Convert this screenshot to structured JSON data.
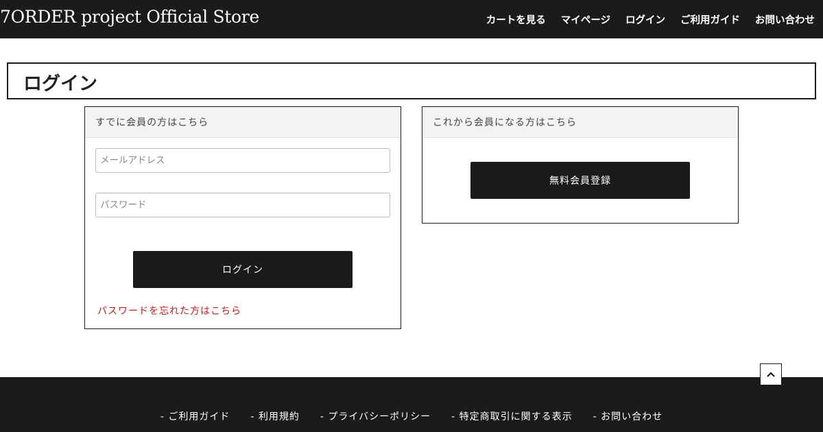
{
  "header": {
    "site_title": "7ORDER project Official Store",
    "nav": [
      {
        "label": "カートを見る"
      },
      {
        "label": "マイページ"
      },
      {
        "label": "ログイン"
      },
      {
        "label": "ご利用ガイド"
      },
      {
        "label": "お問い合わせ"
      }
    ]
  },
  "page": {
    "title": "ログイン"
  },
  "login_panel": {
    "heading": "すでに会員の方はこちら",
    "email_placeholder": "メールアドレス",
    "email_value": "",
    "password_placeholder": "パスワード",
    "password_value": "",
    "login_button": "ログイン",
    "forgot_link": "パスワードを忘れた方はこちら"
  },
  "register_panel": {
    "heading": "これから会員になる方はこちら",
    "register_button": "無料会員登録"
  },
  "back_to_top": {
    "icon": "chevron-up-icon"
  },
  "footer": {
    "links": [
      {
        "label": "- ご利用ガイド"
      },
      {
        "label": "- 利用規約"
      },
      {
        "label": "- プライバシーポリシー"
      },
      {
        "label": "- 特定商取引に関する表示"
      },
      {
        "label": "- お問い合わせ"
      }
    ]
  },
  "colors": {
    "header_bg": "#1b1b1b",
    "button_bg": "#1b1b1b",
    "link_red": "#d31a1a",
    "panel_head_bg": "#f3f3f3"
  }
}
